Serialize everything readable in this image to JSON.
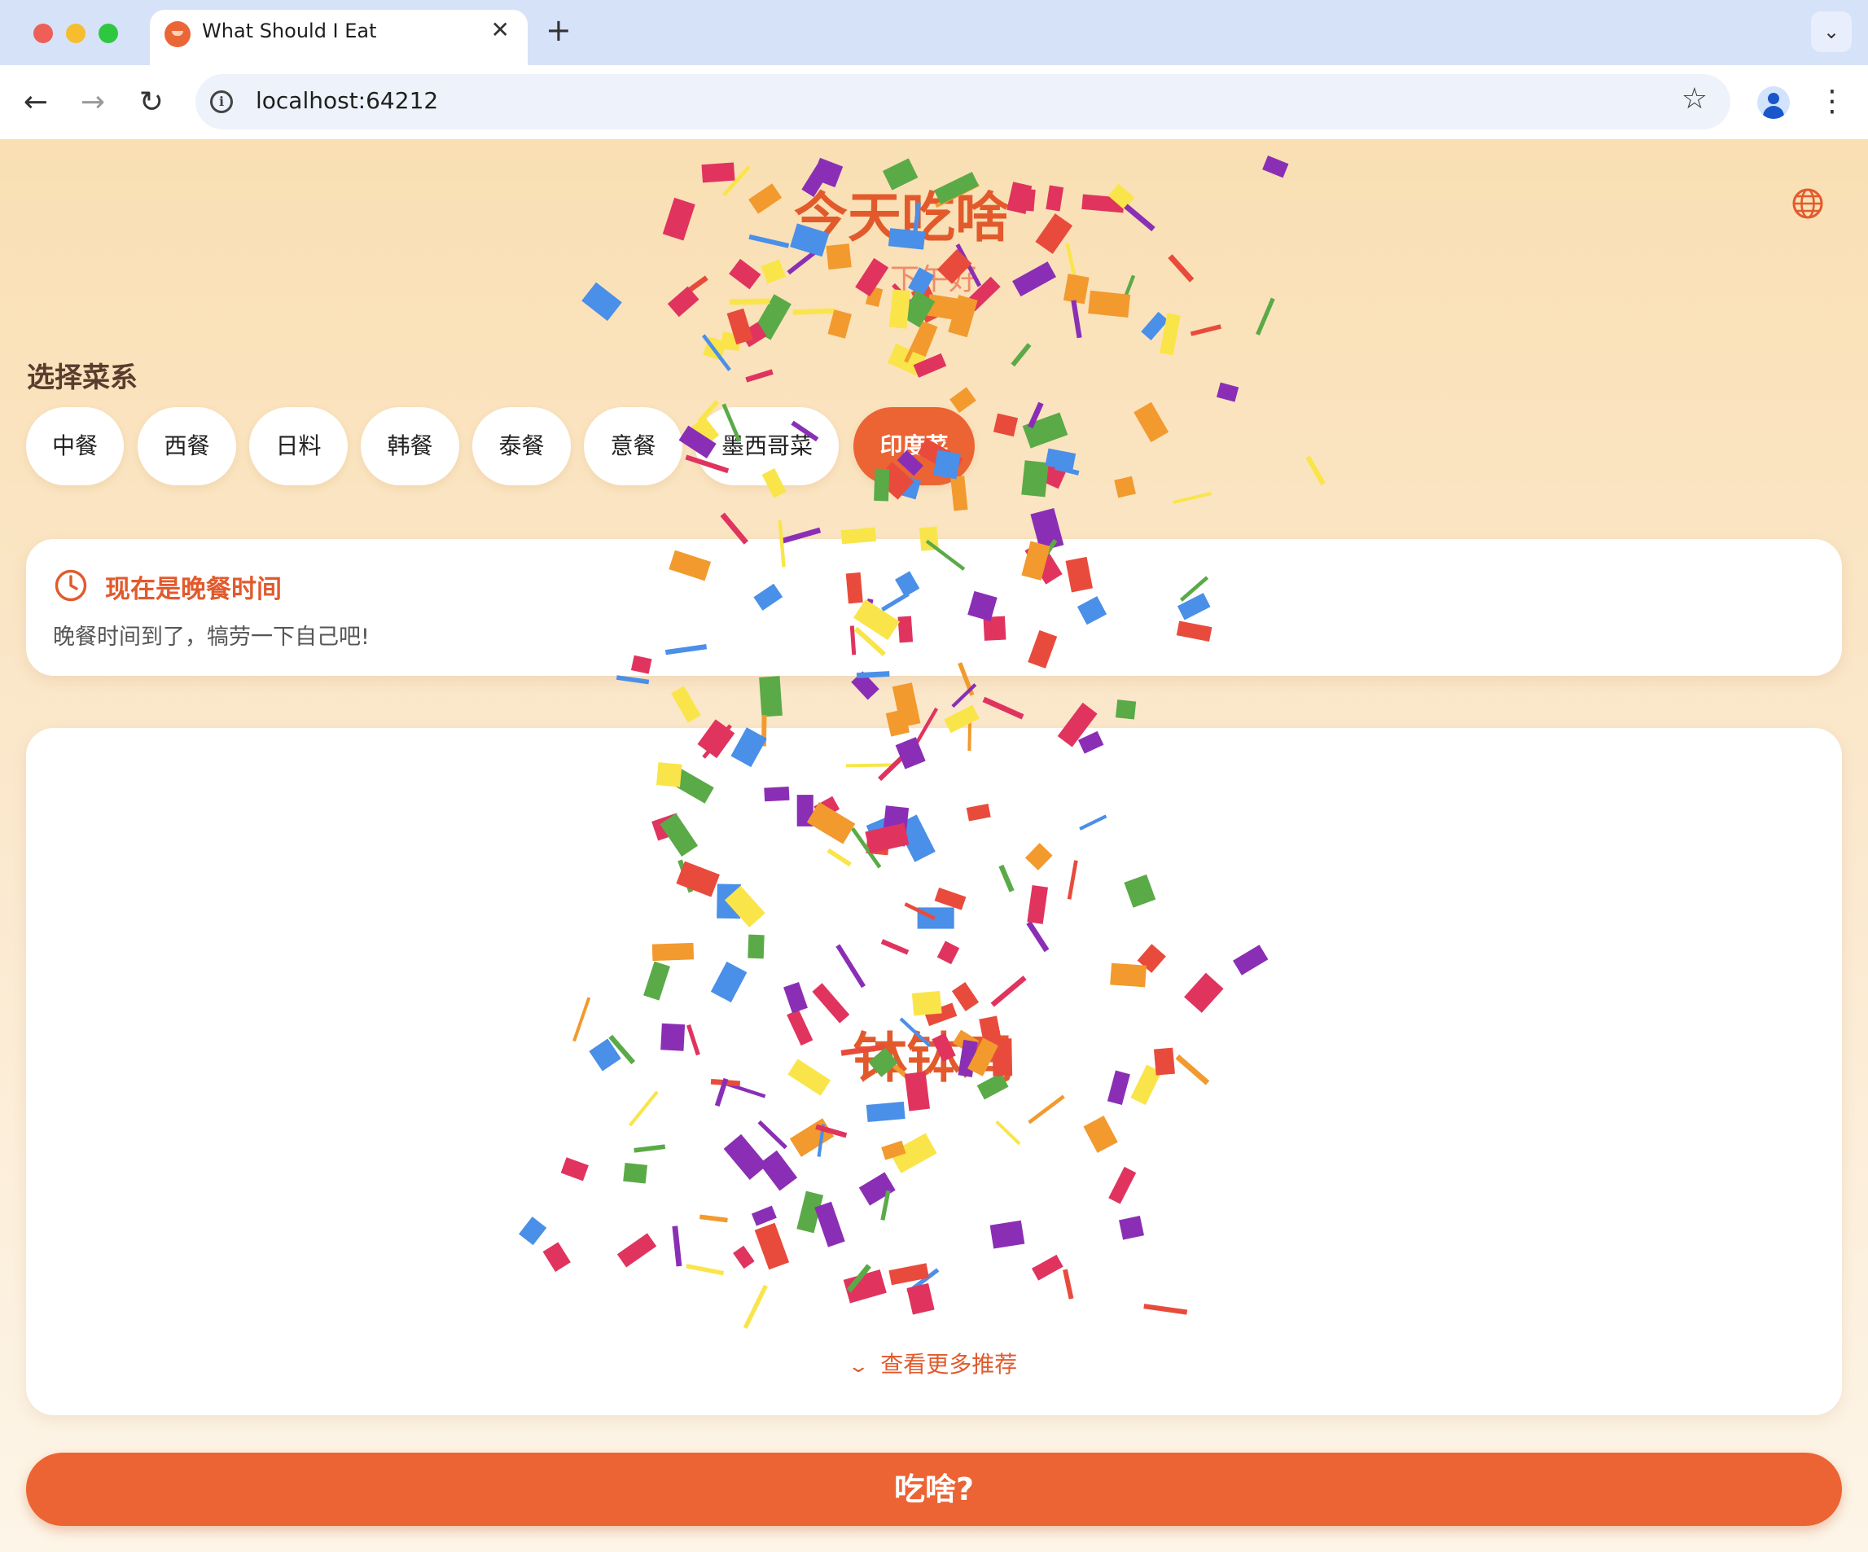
{
  "browser": {
    "tab_title": "What Should I Eat",
    "tab_close": "✕",
    "new_tab": "+",
    "url": "localhost:64212",
    "icons": [
      "back-arrow-icon",
      "forward-arrow-icon",
      "reload-icon",
      "site-info-icon",
      "bookmark-star-icon",
      "profile-icon",
      "menu-dots-icon",
      "tab-search-chevron-icon"
    ]
  },
  "header": {
    "title": "今天吃啥",
    "greeting": "下午好"
  },
  "cuisine": {
    "label": "选择菜系",
    "options": [
      {
        "label": "中餐",
        "selected": false
      },
      {
        "label": "西餐",
        "selected": false
      },
      {
        "label": "日料",
        "selected": false
      },
      {
        "label": "韩餐",
        "selected": false
      },
      {
        "label": "泰餐",
        "selected": false
      },
      {
        "label": "意餐",
        "selected": false
      },
      {
        "label": "墨西哥菜",
        "selected": false
      },
      {
        "label": "印度菜",
        "selected": true
      }
    ]
  },
  "meal_time": {
    "title": "现在是晚餐时间",
    "description": "晚餐时间到了，犒劳一下自己吧!"
  },
  "result": {
    "dish": "钵钵鸡",
    "more_label": "查看更多推荐"
  },
  "action": {
    "button_label": "吃啥?"
  },
  "colors": {
    "accent": "#ec6334",
    "title": "#e25a2c",
    "confetti": [
      "#e0345f",
      "#4a8fe8",
      "#5aaa48",
      "#f29a2e",
      "#f9e54a",
      "#8a2fb5",
      "#e84b3c"
    ]
  }
}
